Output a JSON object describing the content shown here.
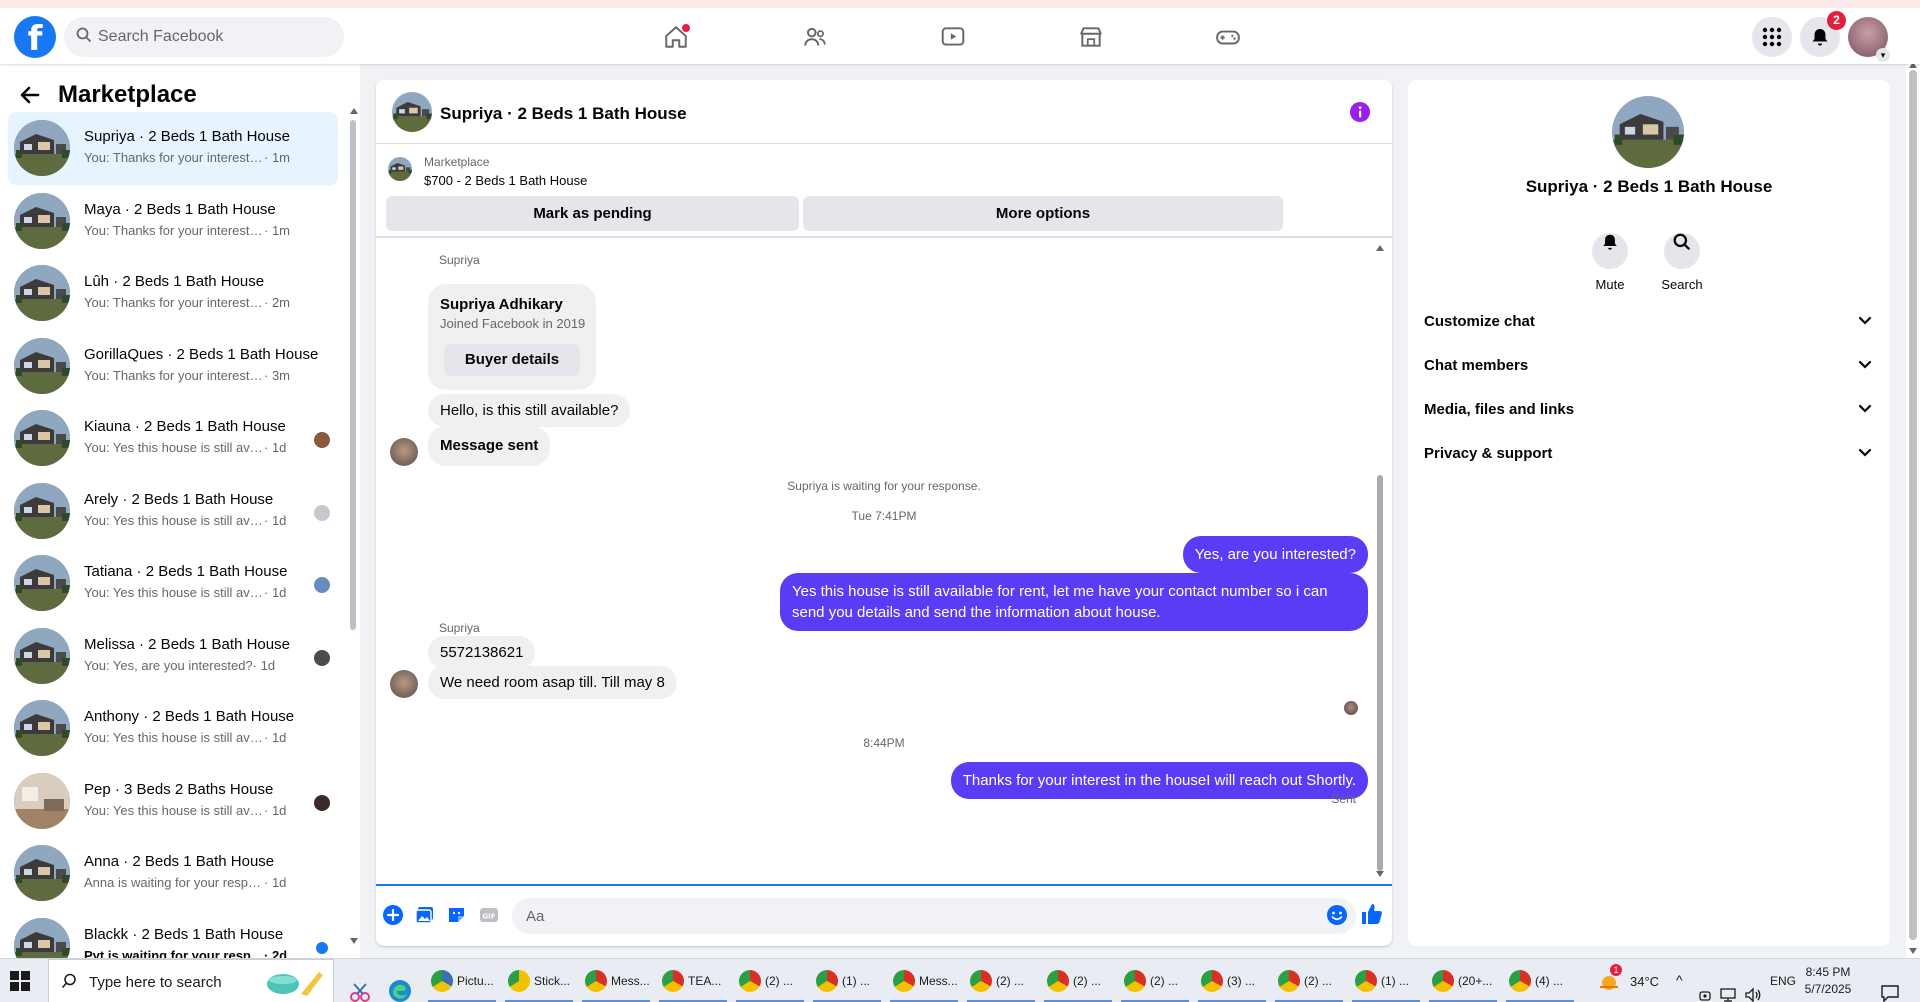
{
  "topbar": {
    "search_placeholder": "Search Facebook",
    "notifications_count": "2",
    "nav_tabs": [
      "home-icon",
      "friends-icon",
      "watch-icon",
      "marketplace-icon",
      "gaming-icon"
    ]
  },
  "left": {
    "title": "Marketplace",
    "conversations": [
      {
        "title": "Supriya · 2 Beds 1 Bath House",
        "snippet": "You: Thanks for your interest in the...",
        "time": " · 1m",
        "active": true
      },
      {
        "title": "Maya · 2 Beds 1 Bath House",
        "snippet": "You: Thanks for your interest in the...",
        "time": " · 1m"
      },
      {
        "title": "Lûh · 2 Beds 1 Bath House",
        "snippet": "You: Thanks for your interest in the...",
        "time": " · 2m"
      },
      {
        "title": "GorillaQues · 2 Beds 1 Bath House",
        "snippet": "You: Thanks for your interest in the...",
        "time": " · 3m"
      },
      {
        "title": "Kiauna · 2 Beds 1 Bath House",
        "snippet": "You: Yes this house is still availab...",
        "time": " · 1d"
      },
      {
        "title": "Arely · 2 Beds 1 Bath House",
        "snippet": "You: Yes this house is still availab...",
        "time": " · 1d"
      },
      {
        "title": "Tatiana · 2 Beds 1 Bath House",
        "snippet": "You: Yes this house is still availab...",
        "time": " · 1d"
      },
      {
        "title": "Melissa · 2 Beds 1 Bath House",
        "snippet": "You: Yes, are you interested?",
        "time": " · 1d"
      },
      {
        "title": "Anthony · 2 Beds 1 Bath House",
        "snippet": "You: Yes this house is still available ...",
        "time": " · 1d"
      },
      {
        "title": "Pep · 3 Beds 2 Baths House",
        "snippet": "You: Yes this house is still availab...",
        "time": " · 1d"
      },
      {
        "title": "Anna · 2 Beds 1 Bath House",
        "snippet": "Anna is waiting for your response.",
        "time": " · 1d"
      },
      {
        "title": "Blackk · 2 Beds 1 Bath House",
        "snippet": "Pyt is waiting for your response.",
        "time": " · 2d",
        "unread": true
      }
    ]
  },
  "chat": {
    "header_name": "Supriya · 2 Beds 1 Bath House",
    "listing_source": "Marketplace",
    "listing_price": "$700 - 2 Beds 1 Bath House",
    "btn_pending": "Mark as pending",
    "btn_more": "More options",
    "sender_label": "Supriya",
    "profile_name": "Supriya Adhikary",
    "profile_joined": "Joined Facebook in 2019",
    "buyer_details": "Buyer details",
    "msg_1": "Hello, is this still available?",
    "msg_2": "Message sent",
    "waiting_note": "Supriya is waiting for your response.",
    "time_1": "Tue 7:41PM",
    "out_1": "Yes, are you interested?",
    "out_2": "Yes this house is still available for rent, let me have your contact number so i can send you details and send the information about house.",
    "in_phone": "5572138621",
    "in_need": "We need room asap till. Till may 8",
    "time_2": "8:44PM",
    "out_3": "Thanks for your interest in the houseI will reach out Shortly.",
    "sent_label": "Sent",
    "composer_placeholder": "Aa"
  },
  "right": {
    "name": "Supriya · 2 Beds 1 Bath House",
    "mute": "Mute",
    "search": "Search",
    "sections": [
      "Customize chat",
      "Chat members",
      "Media, files and links",
      "Privacy & support"
    ]
  },
  "taskbar": {
    "search_text": "Type here to search",
    "apps": [
      {
        "label": "Pictu...",
        "color": "#3a6fb0"
      },
      {
        "label": "Stick...",
        "color": "#f2c200"
      },
      {
        "label": "Mess...",
        "color": "#d93025"
      },
      {
        "label": "TEA...",
        "color": "#d93025"
      },
      {
        "label": "(2) ...",
        "color": "#d93025"
      },
      {
        "label": "(1) ...",
        "color": "#d93025"
      },
      {
        "label": "Mess...",
        "color": "#d93025"
      },
      {
        "label": "(2) ...",
        "color": "#d93025"
      },
      {
        "label": "(2) ...",
        "color": "#d93025"
      },
      {
        "label": "(2) ...",
        "color": "#d93025"
      },
      {
        "label": "(3) ...",
        "color": "#d93025"
      },
      {
        "label": "(2) ...",
        "color": "#d93025"
      },
      {
        "label": "(1) ...",
        "color": "#d93025"
      },
      {
        "label": "(20+...",
        "color": "#d93025"
      },
      {
        "label": "(4) ...",
        "color": "#d93025"
      }
    ],
    "weather": "34°C",
    "weather_badge": "1",
    "lang": "ENG",
    "time": "8:45 PM",
    "date": "5/7/2025"
  }
}
